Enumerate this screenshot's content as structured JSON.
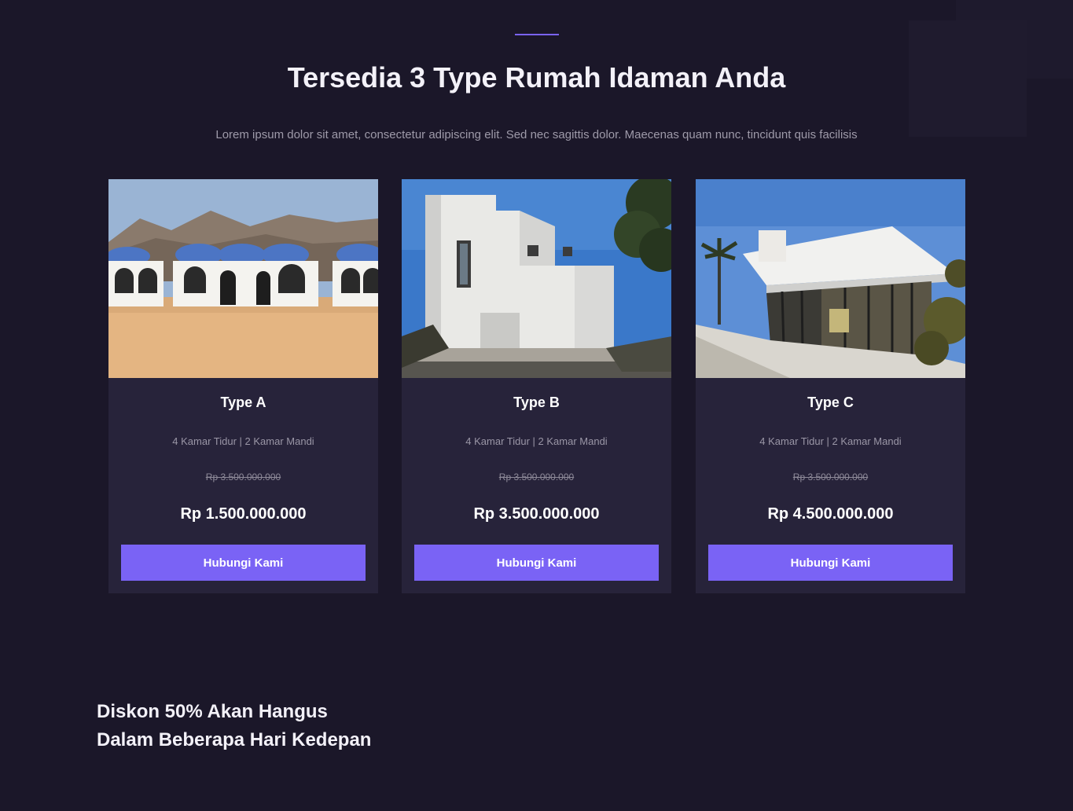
{
  "section": {
    "title": "Tersedia 3 Type Rumah Idaman Anda",
    "description": "Lorem ipsum dolor sit amet, consectetur adipiscing elit. Sed nec sagittis dolor. Maecenas quam nunc, tincidunt quis facilisis"
  },
  "cards": [
    {
      "title": "Type A",
      "rooms": "4 Kamar Tidur | 2 Kamar Mandi",
      "old_price": "Rp 3.500.000.000",
      "price": "Rp 1.500.000.000",
      "button": "Hubungi Kami"
    },
    {
      "title": "Type B",
      "rooms": "4 Kamar Tidur | 2 Kamar Mandi",
      "old_price": "Rp 3.500.000.000",
      "price": "Rp 3.500.000.000",
      "button": "Hubungi Kami"
    },
    {
      "title": "Type C",
      "rooms": "4 Kamar Tidur | 2 Kamar Mandi",
      "old_price": "Rp 3.500.000.000",
      "price": "Rp 4.500.000.000",
      "button": "Hubungi Kami"
    }
  ],
  "promo": {
    "line1": "Diskon 50% Akan Hangus",
    "line2": "Dalam Beberapa Hari Kedepan"
  },
  "colors": {
    "background": "#1b1729",
    "card": "#27233a",
    "accent": "#7a63f5"
  }
}
